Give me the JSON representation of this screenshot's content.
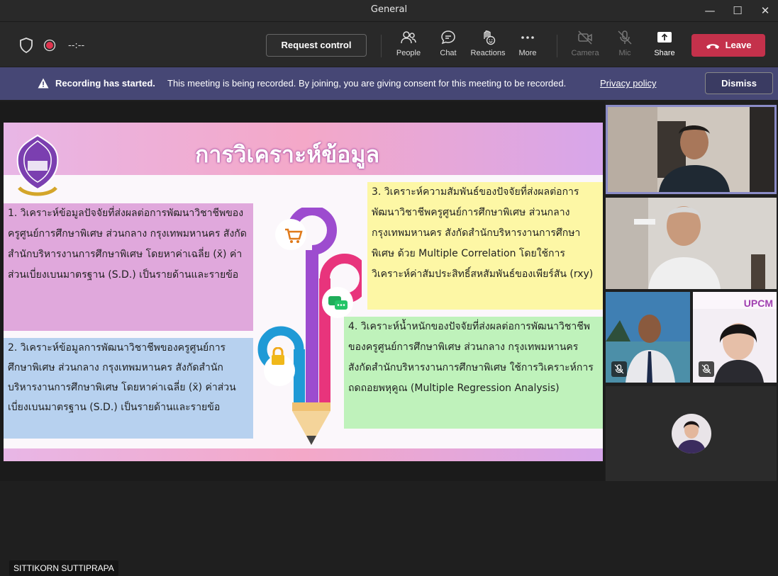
{
  "window": {
    "title": "General"
  },
  "toolbar": {
    "timer": "--:--",
    "request_control": "Request control",
    "people": "People",
    "chat": "Chat",
    "reactions": "Reactions",
    "more": "More",
    "camera": "Camera",
    "mic": "Mic",
    "share": "Share",
    "leave": "Leave"
  },
  "banner": {
    "bold": "Recording has started.",
    "message": "This meeting is being recorded. By joining, you are giving consent for this meeting to be recorded.",
    "link": "Privacy policy",
    "dismiss": "Dismiss"
  },
  "slide": {
    "title": "การวิเคราะห์ข้อมูล",
    "box1": "1. วิเคราะห์ข้อมูลปัจจัยที่ส่งผลต่อการพัฒนาวิชาชีพของครูศูนย์การศึกษาพิเศษ ส่วนกลาง กรุงเทพมหานคร สังกัดสำนักบริหารงานการศึกษาพิเศษ โดยหาค่าเฉลี่ย (x̄) ค่าส่วนเบี่ยงเบนมาตรฐาน (S.D.) เป็นรายด้านและรายข้อ",
    "box2": "2. วิเคราะห์ข้อมูลการพัฒนาวิชาชีพของครูศูนย์การศึกษาพิเศษ ส่วนกลาง กรุงเทพมหานคร สังกัดสำนักบริหารงานการศึกษาพิเศษ โดยหาค่าเฉลี่ย (x̄) ค่าส่วนเบี่ยงเบนมาตรฐาน (S.D.) เป็นรายด้านและรายข้อ",
    "box3": "3. วิเคราะห์ความสัมพันธ์ของปัจจัยที่ส่งผลต่อการพัฒนาวิชาชีพครูศูนย์การศึกษาพิเศษ ส่วนกลาง กรุงเทพมหานคร สังกัดสำนักบริหารงานการศึกษาพิเศษ ด้วย Multiple Correlation โดยใช้การวิเคราะห์ค่าสัมประสิทธิ์สหสัมพันธ์ของเพียร์สัน (rxy)",
    "box4": "4. วิเคราะห์น้ำหนักของปัจจัยที่ส่งผลต่อการพัฒนาวิชาชีพของครูศูนย์การศึกษาพิเศษ ส่วนกลาง กรุงเทพมหานคร สังกัดสำนักบริหารงานการศึกษาพิเศษ ใช้การวิเคราะห์การถดถอยพหุคูณ (Multiple Regression Analysis)"
  },
  "presenter": {
    "name": "SITTIKORN SUTTIPRAPA"
  },
  "tiles": {
    "upcm_label": "UPCM"
  },
  "colors": {
    "leave": "#c4314b",
    "banner": "#464775",
    "accent": "#8b8cc7"
  }
}
